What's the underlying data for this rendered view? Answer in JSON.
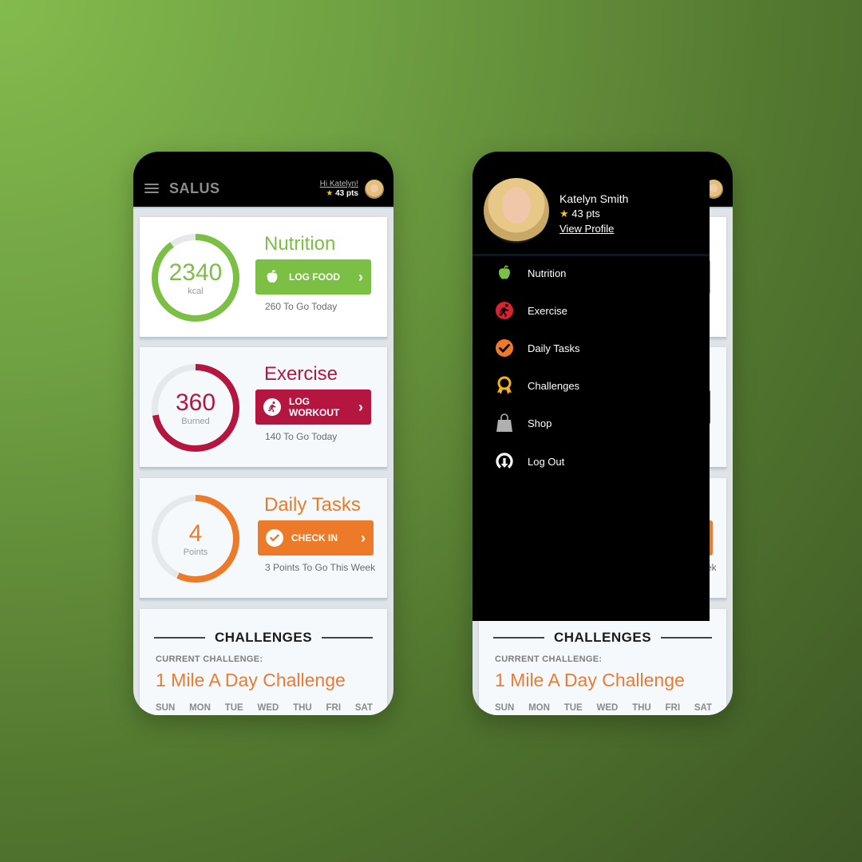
{
  "colors": {
    "nutrition": "#7bbf45",
    "exercise": "#b5163f",
    "tasks": "#ec7a28",
    "ring_track": "#e5e9ec",
    "challenge_accent": "#ec7a32",
    "star": "#f5c518"
  },
  "app": {
    "brand": "SALUS",
    "greeting": "Hi Katelyn!",
    "points": "43 pts"
  },
  "cards": [
    {
      "title": "Nutrition",
      "value": "2340",
      "unit": "kcal",
      "progress": 0.9,
      "button_label": "LOG FOOD",
      "button_icon": "apple-icon",
      "subtext": "260 To Go Today"
    },
    {
      "title": "Exercise",
      "value": "360",
      "unit": "Burned",
      "progress": 0.72,
      "button_label": "LOG WORKOUT",
      "button_icon": "runner-icon",
      "subtext": "140 To Go Today"
    },
    {
      "title": "Daily Tasks",
      "value": "4",
      "unit": "Points",
      "progress": 0.57,
      "button_label": "CHECK IN",
      "button_icon": "check-icon",
      "subtext": "3 Points To Go This Week"
    }
  ],
  "challenges": {
    "heading": "CHALLENGES",
    "current_label": "CURRENT CHALLENGE:",
    "current_name": "1 Mile A Day Challenge",
    "days": [
      "SUN",
      "MON",
      "TUE",
      "WED",
      "THU",
      "FRI",
      "SAT"
    ]
  },
  "drawer": {
    "name": "Katelyn Smith",
    "points": "43 pts",
    "view_profile": "View Profile",
    "items": [
      {
        "label": "Nutrition",
        "icon": "apple-icon"
      },
      {
        "label": "Exercise",
        "icon": "runner-icon"
      },
      {
        "label": "Daily Tasks",
        "icon": "check-icon"
      },
      {
        "label": "Challenges",
        "icon": "award-ribbon-icon"
      },
      {
        "label": "Shop",
        "icon": "shopping-bag-icon"
      },
      {
        "label": "Log Out",
        "icon": "logout-icon"
      }
    ],
    "peek_subtext_fragment": "ek"
  }
}
